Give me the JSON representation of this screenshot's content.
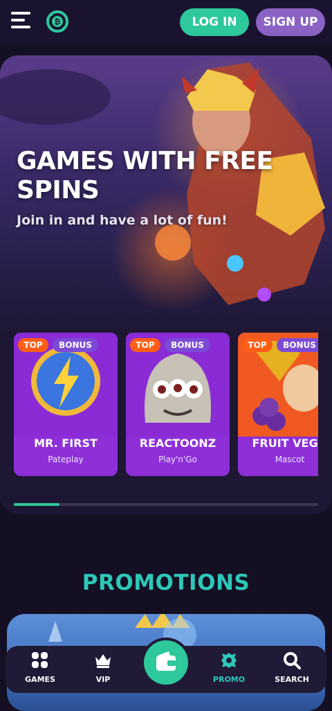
{
  "header": {
    "login_label": "LOG IN",
    "signup_label": "SIGN UP",
    "logo_icon": "bitcoin-coin-logo",
    "menu_icon": "hamburger-menu-icon"
  },
  "hero": {
    "title": "GAMES WITH FREE SPINS",
    "subtitle": "Join in and have a lot of fun!"
  },
  "games": [
    {
      "name": "MR. FIRST",
      "provider": "Pateplay",
      "badges": [
        "TOP",
        "BONUS"
      ]
    },
    {
      "name": "REACTOONZ",
      "provider": "Play'n'Go",
      "badges": [
        "TOP",
        "BONUS"
      ]
    },
    {
      "name": "FRUIT VEGAS",
      "provider": "Mascot",
      "badges": [
        "TOP",
        "BONUS"
      ]
    }
  ],
  "promotions": {
    "title": "PROMOTIONS"
  },
  "bottom_nav": {
    "items": [
      {
        "label": "GAMES",
        "icon": "grid-icon"
      },
      {
        "label": "VIP",
        "icon": "crown-icon"
      },
      {
        "label": "PROMO",
        "icon": "promo-badge-icon",
        "active": true
      },
      {
        "label": "SEARCH",
        "icon": "search-icon"
      }
    ],
    "center_icon": "wallet-icon"
  },
  "colors": {
    "accent": "#2dc89b",
    "signup": "#8a62c4",
    "badge_top": "#ff5e17",
    "badge_bonus": "#7c4bd6",
    "promo_title": "#2dc8b9",
    "background": "#140f22"
  }
}
